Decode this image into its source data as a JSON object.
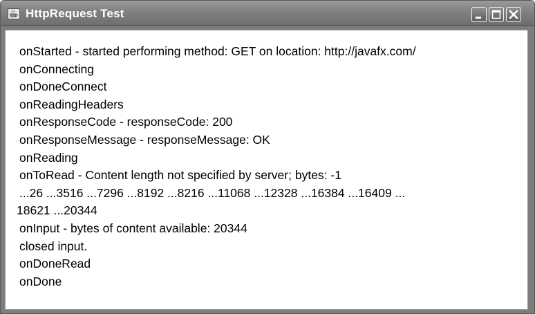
{
  "window": {
    "title": "HttpRequest Test",
    "icon": "java-cup-icon"
  },
  "controls": {
    "minimize": "minimize-icon",
    "maximize": "maximize-icon",
    "close": "close-icon"
  },
  "log": {
    "lines": [
      "onStarted - started performing method: GET on location: http://javafx.com/",
      "onConnecting",
      "onDoneConnect",
      "onReadingHeaders",
      "onResponseCode - responseCode: 200",
      "onResponseMessage - responseMessage: OK",
      "onReading",
      "onToRead - Content length not specified by server; bytes: -1",
      "...26  ...3516  ...7296  ...8192  ...8216  ...11068  ...12328  ...16384  ...16409  ...",
      "18621  ...20344",
      "onInput - bytes of content available: 20344",
      "closed input.",
      "onDoneRead",
      "onDone"
    ]
  }
}
